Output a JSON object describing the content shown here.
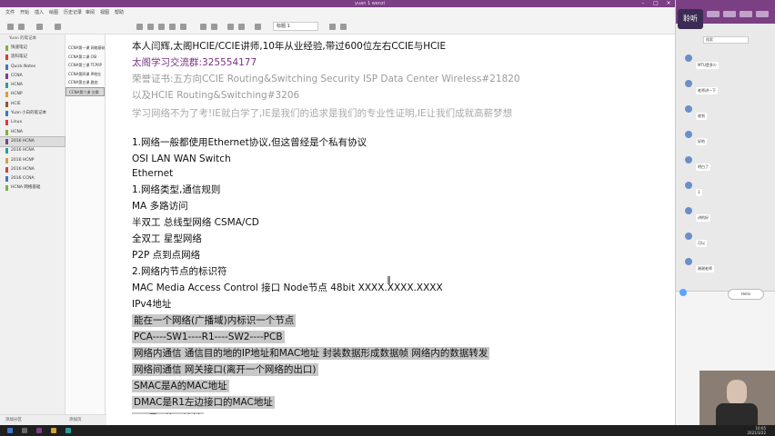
{
  "window": {
    "title": "yuan 1 wenzi"
  },
  "ribbon": {
    "tabs": [
      "文件",
      "开始",
      "插入",
      "绘图",
      "历史记录",
      "审阅",
      "视图",
      "帮助"
    ],
    "style_value": "标题 1"
  },
  "sidebar": {
    "header": "Yuan 的笔记本",
    "items": [
      {
        "label": "快速笔记",
        "color": "#7bb33a"
      },
      {
        "label": "思科笔记",
        "color": "#d43d3d"
      },
      {
        "label": "Quick Notes",
        "color": "#3b78c7"
      },
      {
        "label": "CCNA",
        "color": "#7b3f84"
      },
      {
        "label": "HCNA",
        "color": "#2c9c9c"
      },
      {
        "label": "HCNP",
        "color": "#d4a03d"
      },
      {
        "label": "HCIE",
        "color": "#8b5a2b"
      },
      {
        "label": "Yuan 小白的笔记本",
        "color": "#3b78c7"
      },
      {
        "label": "Linux",
        "color": "#d43d3d"
      },
      {
        "label": "HCNA",
        "color": "#7bb33a"
      },
      {
        "label": "2016 HCNA",
        "color": "#7b3f84"
      },
      {
        "label": "2016 HCNA",
        "color": "#2c9c9c"
      },
      {
        "label": "2016 HCNP",
        "color": "#d4a03d"
      },
      {
        "label": "2016 HCNA",
        "color": "#d43d3d"
      },
      {
        "label": "2016 CCNA",
        "color": "#3b78c7"
      },
      {
        "label": "HCNA 网络基础",
        "color": "#7bb33a"
      }
    ]
  },
  "pages": {
    "items": [
      "CCNA第一课 网络基础",
      "CCNA第二课 OSI",
      "CCNA第三课 TCP/IP",
      "CCNA第四课 IP地址",
      "CCNA第五课 路由",
      "CCNA第六课 交换"
    ]
  },
  "bottombar": {
    "add_section": "添加分区",
    "add_page": "添加页"
  },
  "note": {
    "lines": [
      {
        "text": "本人闫辉,太阁HCIE/CCIE讲师,10年从业经验,带过600位左右CCIE与HCIE",
        "style": "dark"
      },
      {
        "text": "太阁学习交流群:325554177",
        "style": "purple"
      },
      {
        "text": "荣誉证书:五方向CCIE Routing&Switching Security ISP Data Center Wireless#21820",
        "style": "gray"
      },
      {
        "text": "以及HCIE Routing&Switching#3206",
        "style": "gray"
      },
      {
        "text": "学习网络不为了考!IE就白学了,IE是我们的追求是我们的专业性证明,IE让我们成就高薪梦想",
        "style": "lgray"
      },
      {
        "text": "1.网络一般都使用Ethernet协议,但这曾经是个私有协议",
        "style": "dark"
      },
      {
        "text": "OSI LAN WAN Switch",
        "style": "dark"
      },
      {
        "text": "Ethernet",
        "style": "dark"
      },
      {
        "text": "1.网络类型,通信规则",
        "style": "dark"
      },
      {
        "text": "MA 多路访问",
        "style": "dark"
      },
      {
        "text": "半双工  总线型网络 CSMA/CD",
        "style": "dark"
      },
      {
        "text": "全双工  星型网络",
        "style": "dark"
      },
      {
        "text": "P2P 点到点网络",
        "style": "dark"
      },
      {
        "text": "2.网络内节点的标识符",
        "style": "dark"
      },
      {
        "text": "MAC Media Access Control 接口 Node节点 48bit  XXXX.XXXX.XXXX",
        "style": "dark"
      },
      {
        "text": "IPv4地址",
        "style": "dark"
      },
      {
        "text": "能在一个网络(广播域)内标识一个节点",
        "style": "hl"
      },
      {
        "text": "PCA----SW1----R1----SW2----PCB",
        "style": "hl"
      },
      {
        "text": "网络内通信 通信目的地的IP地址和MAC地址 封装数据形成数据帧 网络内的数据转发",
        "style": "hl"
      },
      {
        "text": "网络间通信 网关接口(离开一个网络的出口)",
        "style": "hl"
      },
      {
        "text": "SMAC是A的MAC地址",
        "style": "hl"
      },
      {
        "text": "DMAC是R1左边接口的MAC地址",
        "style": "hl"
      },
      {
        "text": "SIP是A的IP地址",
        "style": "hl"
      }
    ]
  },
  "chat": {
    "brand": "聆听",
    "search_placeholder": "搜索",
    "messages": [
      "MTU是多少",
      "老师讲一下",
      "收到",
      "好的",
      "明白了",
      "1",
      "讲的好",
      "可以",
      "谢谢老师"
    ],
    "float_button": "Hello"
  },
  "taskbar": {
    "time": "10:05",
    "date": "2021/3/22"
  }
}
